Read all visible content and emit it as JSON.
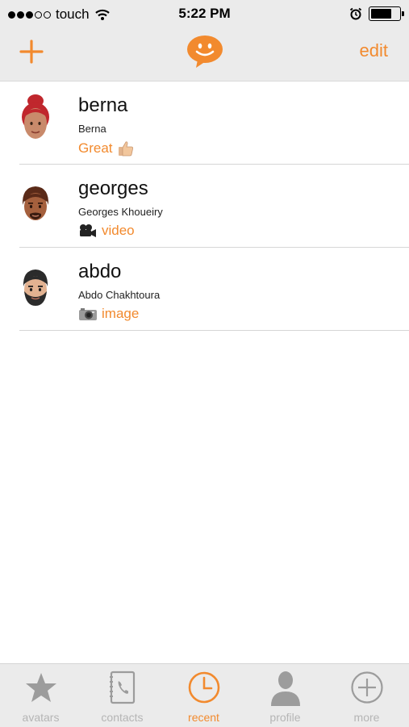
{
  "status_bar": {
    "carrier": "touch",
    "time": "5:22 PM",
    "signal_bars_filled": 3,
    "signal_bars_total": 5,
    "battery_level": 0.74
  },
  "nav": {
    "add_icon": "plus-icon",
    "logo_icon": "smiley-speech-bubble-icon",
    "edit_label": "edit"
  },
  "conversations": [
    {
      "name": "berna",
      "full_name": "Berna",
      "last_message": "Great",
      "last_icon": "thumbs-up-icon"
    },
    {
      "name": "georges",
      "full_name": "Georges Khoueiry",
      "last_message": "video",
      "last_icon": "video-camera-icon"
    },
    {
      "name": "abdo",
      "full_name": "Abdo Chakhtoura",
      "last_message": "image",
      "last_icon": "camera-icon"
    }
  ],
  "tabs": [
    {
      "label": "avatars",
      "icon": "star-icon",
      "active": false
    },
    {
      "label": "contacts",
      "icon": "phone-book-icon",
      "active": false
    },
    {
      "label": "recent",
      "icon": "clock-icon",
      "active": true
    },
    {
      "label": "profile",
      "icon": "person-icon",
      "active": false
    },
    {
      "label": "more",
      "icon": "plus-circle-icon",
      "active": false
    }
  ],
  "colors": {
    "accent": "#f28a2e",
    "bar_bg": "#ebebeb",
    "inactive": "#b5b5b5"
  }
}
